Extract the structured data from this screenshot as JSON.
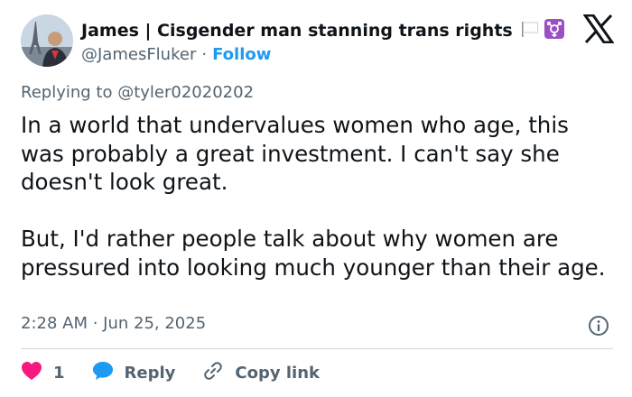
{
  "author": {
    "name": "James | Cisgender man stanning trans rights",
    "handle": "@JamesFluker",
    "separator": "·",
    "follow_label": "Follow",
    "name_icons": [
      "white-flag-icon",
      "transgender-symbol-icon"
    ]
  },
  "reply_context": {
    "prefix": "Replying to",
    "mention": "@tyler02020202"
  },
  "tweet": {
    "paragraphs": [
      "In a world that undervalues women who age, this was probably a great investment. I can't say she doesn't look great.",
      "But, I'd rather people talk about why women are pressured into looking much younger than their age."
    ],
    "timestamp": "2:28 AM · Jun 25, 2025"
  },
  "actions": {
    "like_count": "1",
    "reply_label": "Reply",
    "copy_link_label": "Copy link"
  },
  "colors": {
    "text": "#0f1419",
    "secondary": "#536471",
    "accent": "#1d9bf0",
    "like": "#f91880",
    "divider": "#cfd9de",
    "trans_purple": "#9b4fc4"
  }
}
